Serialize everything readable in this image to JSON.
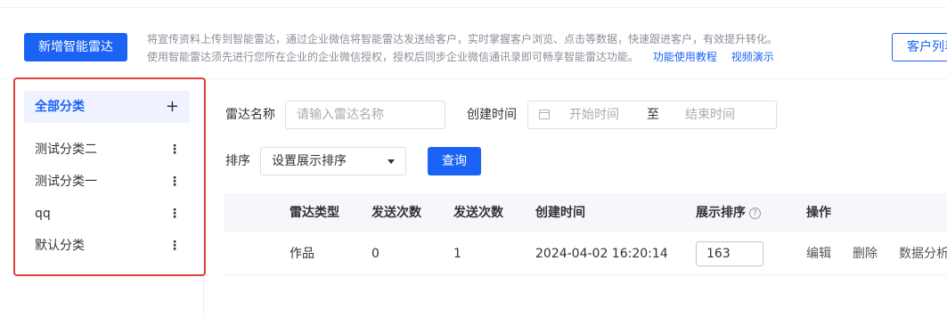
{
  "header": {
    "new_button": "新增智能雷达",
    "tip_line1": "将宣传资料上传到智能雷达，通过企业微信将智能雷达发送给客户，实时掌握客户浏览、点击等数据，快速跟进客户，有效提升转化。",
    "tip_line2": "使用智能雷达须先进行您所在企业的企业微信授权，授权后同步企业微信通讯录即可畅享智能雷达功能。",
    "tutorial_link": "功能使用教程",
    "video_link": "视频演示",
    "customer_list_button": "客户列表"
  },
  "sidebar": {
    "all_label": "全部分类",
    "add_icon": "+",
    "more_icon": "⋮",
    "items": [
      {
        "label": "测试分类二"
      },
      {
        "label": "测试分类一"
      },
      {
        "label": "qq"
      },
      {
        "label": "默认分类"
      }
    ],
    "highlight_color": "#e0403a"
  },
  "filters": {
    "name_label": "雷达名称",
    "name_placeholder": "请输入雷达名称",
    "created_label": "创建时间",
    "start_placeholder": "开始时间",
    "range_separator": "至",
    "end_placeholder": "结束时间",
    "sort_label": "排序",
    "sort_value": "设置展示排序",
    "query_button": "查询"
  },
  "table": {
    "columns": [
      "雷达类型",
      "发送次数",
      "发送次数",
      "创建时间",
      "展示排序",
      "操作"
    ],
    "help_icon": "?",
    "rows": [
      {
        "type": "作品",
        "send_count_1": "0",
        "send_count_2": "1",
        "created": "2024-04-02 16:20:14",
        "sort": "163",
        "actions": [
          "编辑",
          "删除",
          "数据分析"
        ]
      }
    ]
  },
  "colors": {
    "accent": "#1b63f5"
  }
}
